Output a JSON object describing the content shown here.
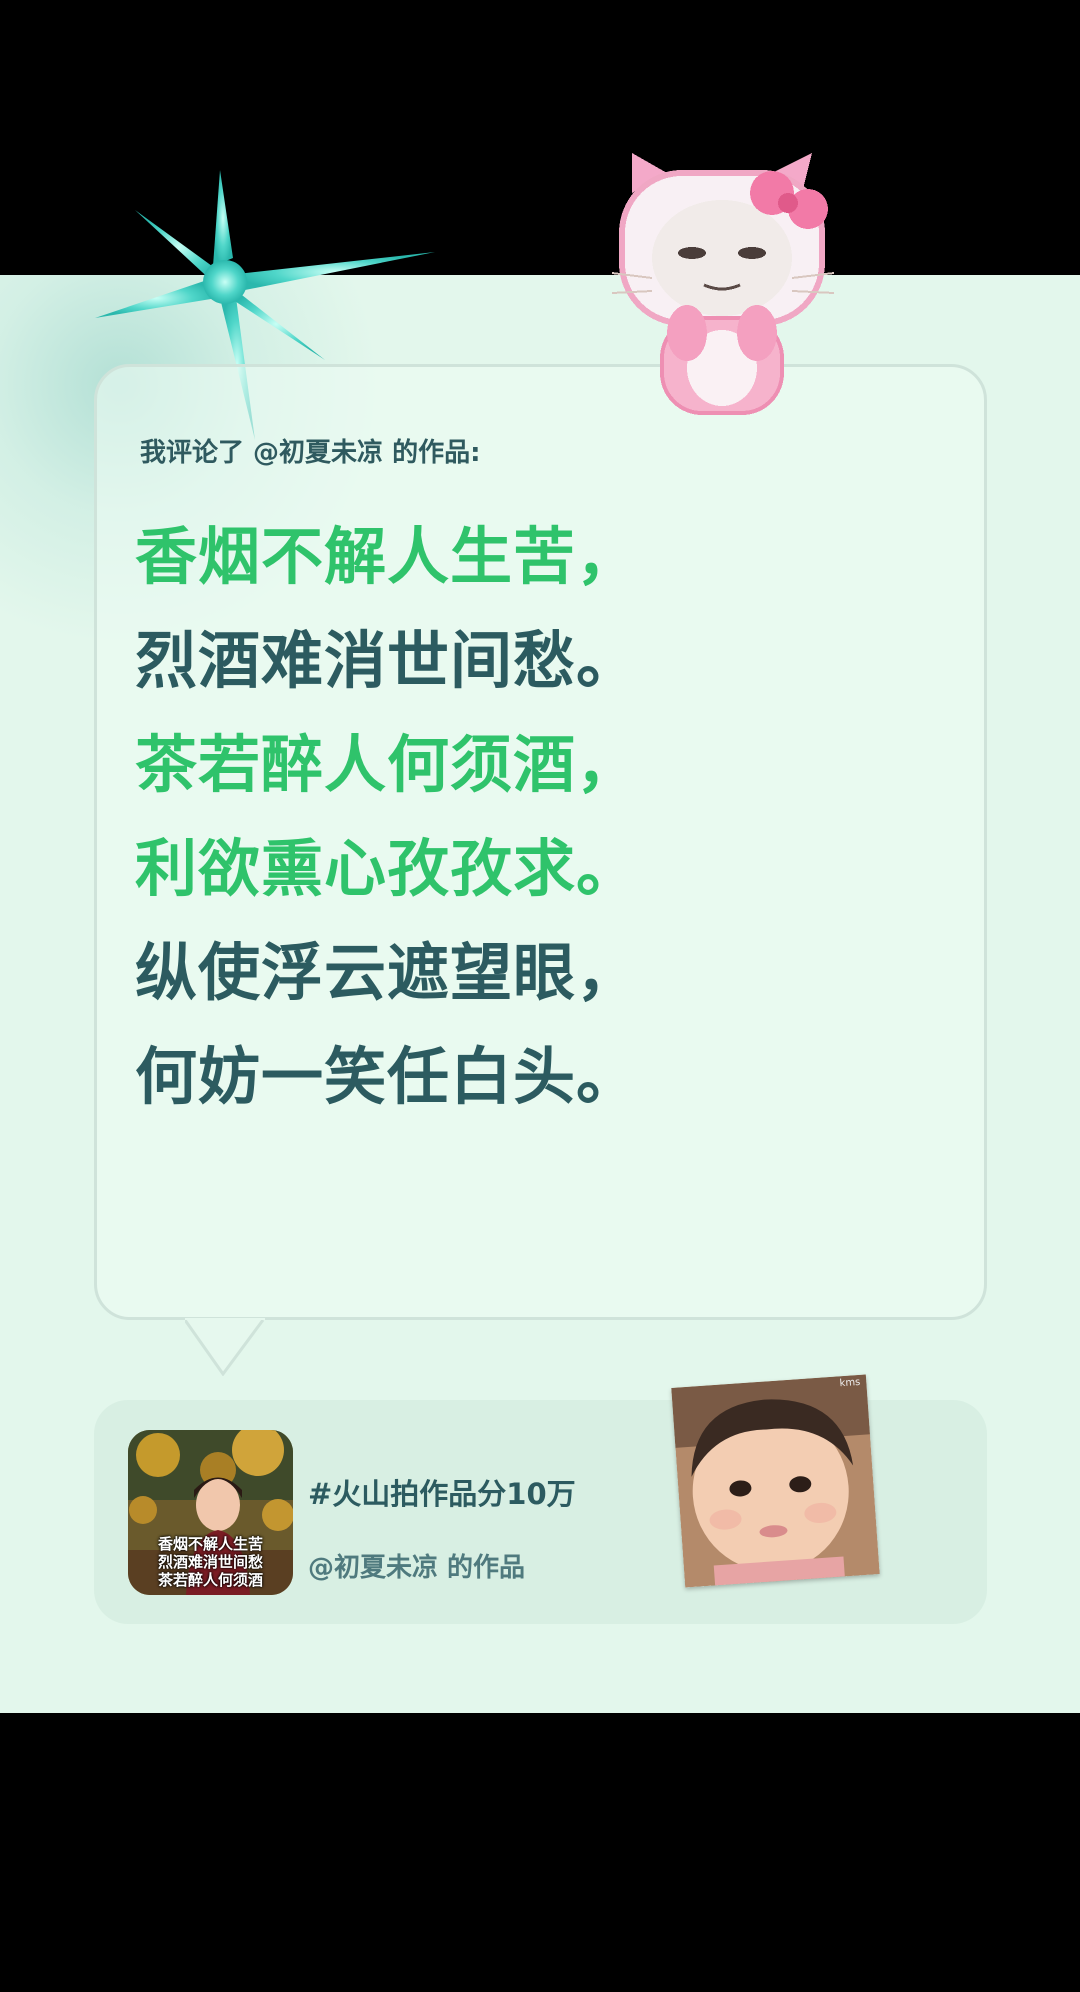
{
  "comment_header": "我评论了 @初夏未凉 的作品:",
  "poem": [
    {
      "text": "香烟不解人生苦，",
      "color": "#2fc36b"
    },
    {
      "text": "烈酒难消世间愁。",
      "color": "#2c5b60"
    },
    {
      "text": "茶若醉人何须酒，",
      "color": "#2fc36b"
    },
    {
      "text": "利欲熏心孜孜求。",
      "color": "#2fc36b"
    },
    {
      "text": "纵使浮云遮望眼，",
      "color": "#2c5b60"
    },
    {
      "text": "何妨一笑任白头。",
      "color": "#2c5b60"
    }
  ],
  "work": {
    "hashtag": "#火山拍作品分10万",
    "author": "@初夏未凉 的作品",
    "thumbnail_text": [
      "香烟不解人生苦",
      "烈酒难消世间愁",
      "茶若醉人何须酒"
    ]
  },
  "stickers": {
    "top": "pink-kitty-sticker",
    "bottom": "baby-face-sticker",
    "bottom_watermark": "kms"
  },
  "colors": {
    "background": "#e3f7ec",
    "accent_green": "#2fc36b",
    "dark_teal": "#2c5b60"
  }
}
